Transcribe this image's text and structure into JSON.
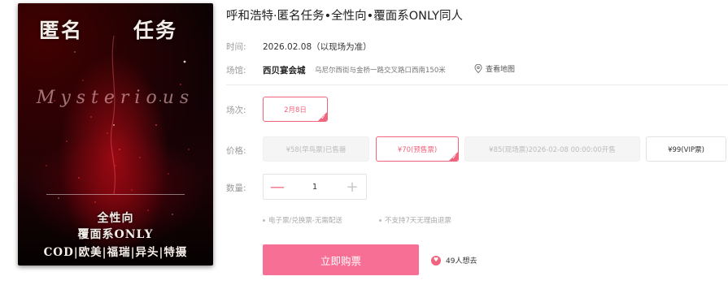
{
  "poster": {
    "title_left": "匿名",
    "title_right": "任务",
    "script_text": "Mysterious",
    "line1": "全性向",
    "line2": "覆面系ONLY",
    "line3": "COD|欧美|福瑞|异头|特摄",
    "colors": {
      "bg": "#140305",
      "accent": "#b0101c"
    }
  },
  "event": {
    "title": "呼和浩特·匿名任务•全性向•覆面系ONLY同人"
  },
  "time": {
    "label": "时间:",
    "value": "2026.02.08（以现场为准）"
  },
  "venue": {
    "label": "场馆:",
    "name": "西贝宴会城",
    "address": "乌尼尔西街与金桥一路交叉路口西南150米",
    "map_label": "查看地图",
    "map_icon": "location-pin-icon"
  },
  "session": {
    "label": "场次:",
    "options": [
      {
        "label": "2月8日",
        "state": "selected"
      }
    ]
  },
  "price": {
    "label": "价格:",
    "options": [
      {
        "label": "¥58(早鸟票)已售罄",
        "state": "disabled"
      },
      {
        "label": "¥70(预售票)",
        "state": "selected"
      },
      {
        "label": "¥85(现场票)2026-02-08 00:00:00开售",
        "state": "disabled"
      },
      {
        "label": "¥99(VIP票)",
        "state": "normal"
      }
    ]
  },
  "quantity": {
    "label": "数量:",
    "value": "1",
    "minus": "—",
    "plus": "+"
  },
  "notes": [
    "电子票/兑换票-无需配送",
    "不支持7天无理由退票"
  ],
  "buy_button": {
    "label": "立即购票",
    "color": "#f76f94"
  },
  "want": {
    "label": "49人想去",
    "icon": "heart-icon"
  },
  "accent_color": "#f0647e"
}
